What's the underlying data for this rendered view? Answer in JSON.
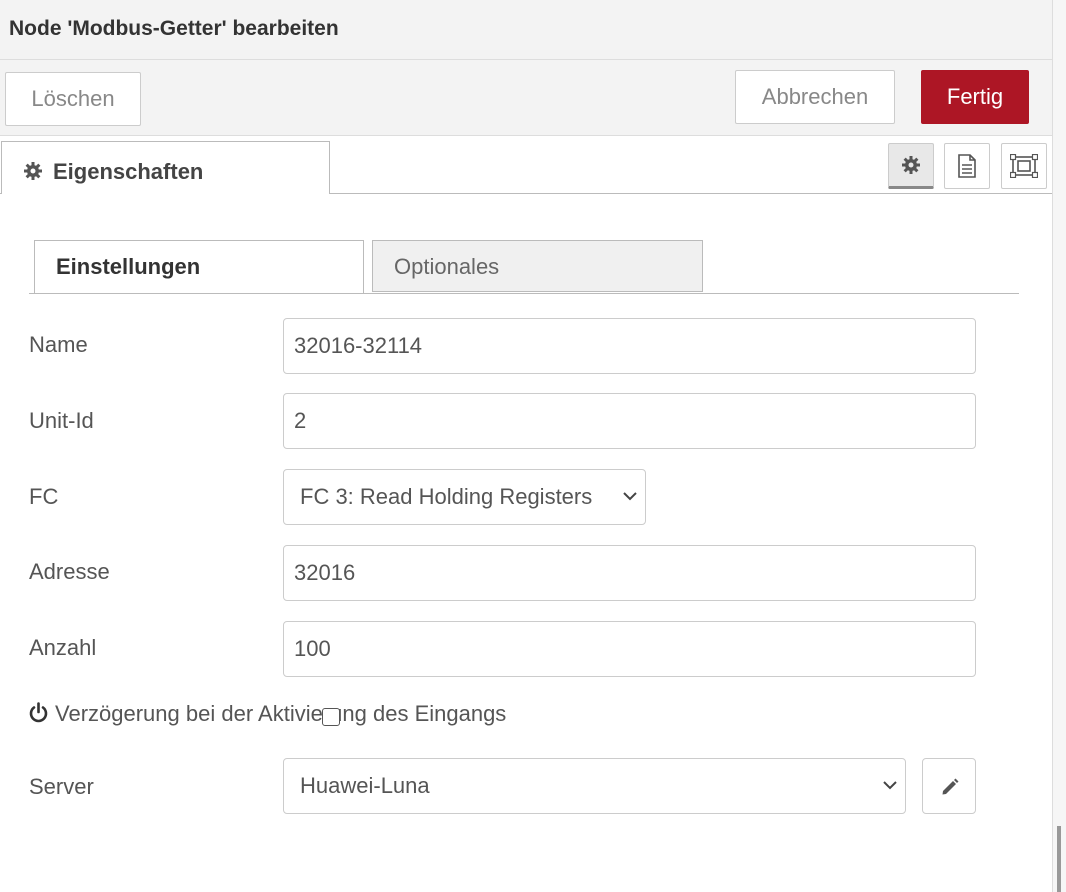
{
  "title": "Node 'Modbus-Getter' bearbeiten",
  "toolbar": {
    "delete_label": "Löschen",
    "cancel_label": "Abbrechen",
    "done_label": "Fertig",
    "done_color": "#ad1625"
  },
  "tabs": {
    "properties_label": "Eigenschaften",
    "icons": [
      "gear-icon",
      "document-icon",
      "frame-icon"
    ]
  },
  "subtabs": {
    "settings_label": "Einstellungen",
    "optional_label": "Optionales"
  },
  "form": {
    "name_label": "Name",
    "name_value": "32016-32114",
    "unitid_label": "Unit-Id",
    "unitid_value": "2",
    "fc_label": "FC",
    "fc_value": "FC 3: Read Holding Registers",
    "address_label": "Adresse",
    "address_value": "32016",
    "count_label": "Anzahl",
    "count_value": "100",
    "delay_label": "Verzögerung bei der Aktivierung des Eingangs",
    "delay_checked": false,
    "server_label": "Server",
    "server_value": "Huawei-Luna"
  }
}
